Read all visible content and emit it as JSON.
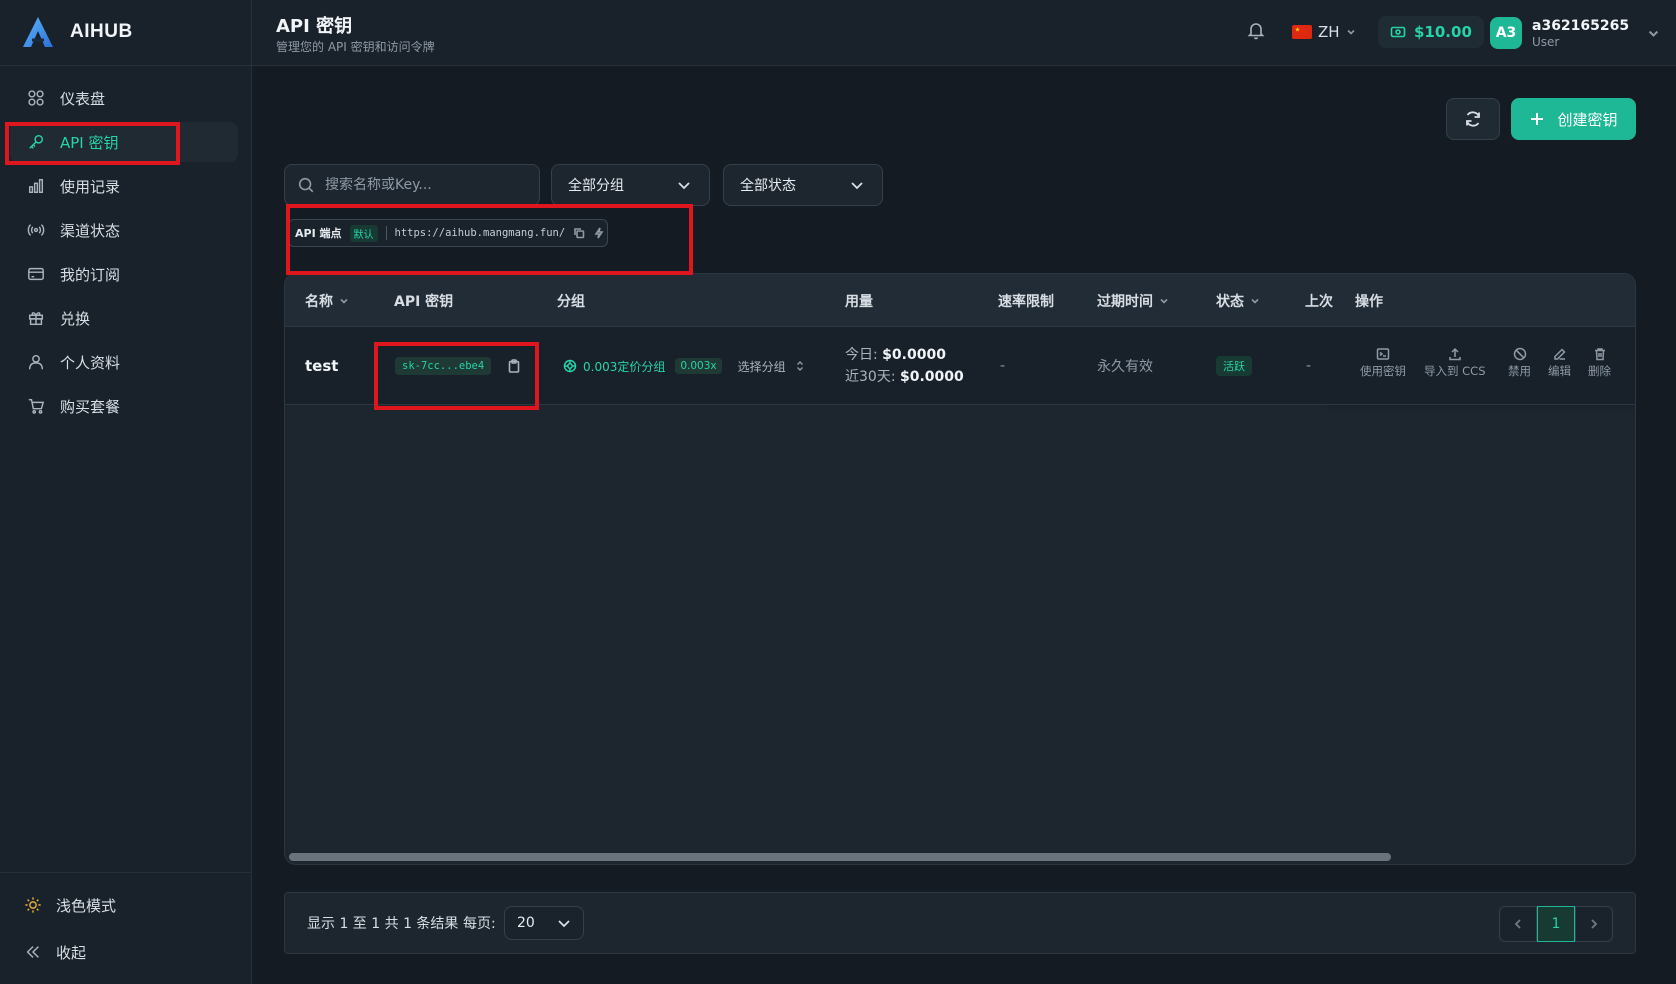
{
  "brand": {
    "name": "AIHUB"
  },
  "sidebar": {
    "items": [
      {
        "label": "仪表盘",
        "icon": "dashboard-icon"
      },
      {
        "label": "API 密钥",
        "icon": "key-icon",
        "active": true
      },
      {
        "label": "使用记录",
        "icon": "bar-chart-icon"
      },
      {
        "label": "渠道状态",
        "icon": "broadcast-icon"
      },
      {
        "label": "我的订阅",
        "icon": "credit-card-icon"
      },
      {
        "label": "兑换",
        "icon": "gift-icon"
      },
      {
        "label": "个人资料",
        "icon": "user-icon"
      },
      {
        "label": "购买套餐",
        "icon": "cart-icon"
      }
    ],
    "theme_toggle": "浅色模式",
    "collapse": "收起"
  },
  "header": {
    "title": "API 密钥",
    "subtitle": "管理您的 API 密钥和访问令牌",
    "language": "ZH",
    "balance": "$10.00",
    "user": {
      "initials": "A3",
      "name": "a362165265",
      "role": "User"
    }
  },
  "toolbar": {
    "create_label": "创建密钥",
    "search_placeholder": "搜索名称或Key...",
    "group_filter": "全部分组",
    "status_filter": "全部状态"
  },
  "endpoint": {
    "label": "API 端点",
    "badge": "默认",
    "url": "https://aihub.mangmang.fun/"
  },
  "table": {
    "columns": {
      "name": "名称",
      "key": "API 密钥",
      "group": "分组",
      "usage": "用量",
      "rate_limit": "速率限制",
      "expires": "过期时间",
      "status": "状态",
      "last_used": "上次",
      "actions": "操作"
    },
    "rows": [
      {
        "name": "test",
        "key": "sk-7cc...ebe4",
        "group": "0.003定价分组",
        "rate": "0.003x",
        "select_group": "选择分组",
        "usage_today_label": "今日:",
        "usage_today": "$0.0000",
        "usage_30d_label": "近30天:",
        "usage_30d": "$0.0000",
        "rate_limit": "-",
        "expires": "永久有效",
        "status": "活跃",
        "last_used": "-"
      }
    ],
    "actions": {
      "use_key": "使用密钥",
      "import_ccs": "导入到 CCS",
      "disable": "禁用",
      "edit": "编辑",
      "delete": "删除"
    },
    "horizontal_scroll_visible_fraction": 0.82
  },
  "footer": {
    "summary": "显示 1 至 1 共 1 条结果",
    "per_page_label": "每页:",
    "per_page_value": "20",
    "current_page": "1"
  },
  "colors": {
    "accent": "#1fb896",
    "accent_text": "#27d3a9",
    "background": "#141b22",
    "highlight_box": "#e0161f"
  }
}
